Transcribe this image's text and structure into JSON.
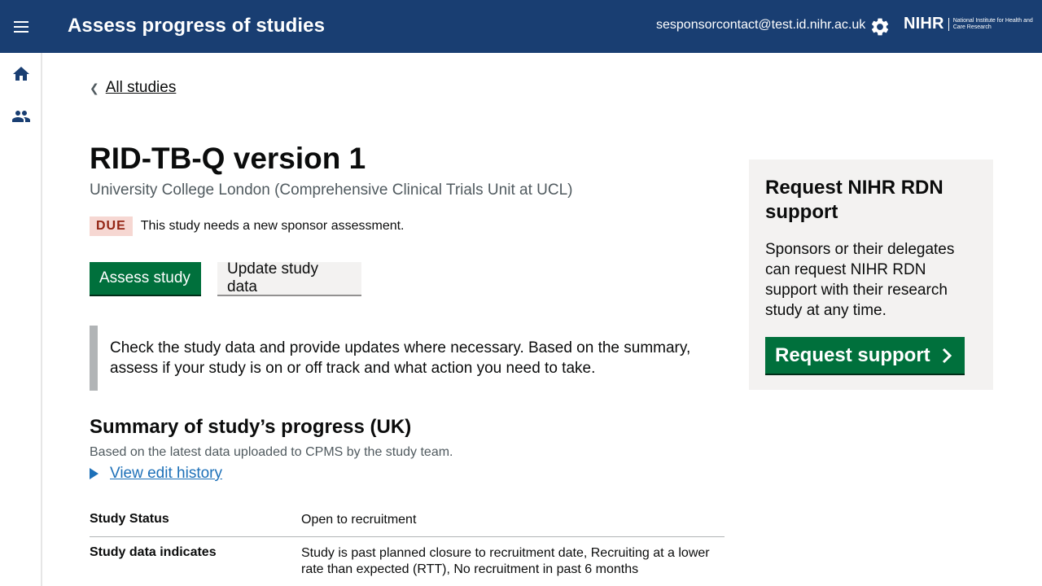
{
  "header": {
    "title": "Assess progress of studies",
    "user_email": "sesponsorcontact@test.id.nihr.ac.uk",
    "logo_main": "NIHR",
    "logo_sub": "National Institute for Health and Care Research"
  },
  "icons": {
    "menu": "menu-icon",
    "settings": "gear-icon",
    "home": "home-icon",
    "users": "users-icon",
    "back": "chevron-left-icon",
    "details": "triangle-right-icon",
    "request": "chevron-right-icon"
  },
  "colors": {
    "header_bg": "#193e72",
    "primary": "#00703c",
    "link": "#1d70b8",
    "due_bg": "#f6d7d2",
    "due_text": "#942514"
  },
  "back_link": {
    "label": "All studies"
  },
  "study": {
    "title": "RID-TB-Q version 1",
    "organisation": "University College London (Comprehensive Clinical Trials Unit at UCL)",
    "status_tag": "DUE",
    "status_text": "This study needs a new sponsor assessment."
  },
  "actions": {
    "assess": "Assess study",
    "update": "Update study data"
  },
  "inset_text": "Check the study data and provide updates where necessary. Based on the summary, assess if your study is on or off track and what action you need to take.",
  "summary": {
    "heading": "Summary of study’s progress (UK)",
    "subheading": "Based on the latest data uploaded to CPMS by the study team.",
    "history_link": "View edit history",
    "rows": [
      {
        "label": "Study Status",
        "value": "Open to recruitment"
      },
      {
        "label": "Study data indicates",
        "value": "Study is past planned closure to recruitment date, Recruiting at a lower rate than expected (RTT), No recruitment in past 6 months"
      }
    ]
  },
  "support_panel": {
    "title": "Request NIHR RDN support",
    "text": "Sponsors or their delegates can request NIHR RDN support with their research study at any time.",
    "button": "Request support"
  }
}
